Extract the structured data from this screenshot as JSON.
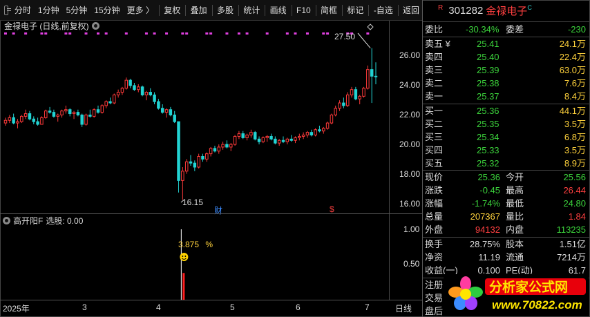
{
  "toolbar": {
    "items": [
      "分时",
      "1分钟",
      "5分钟",
      "15分钟",
      "更多 〉",
      "复权",
      "叠加",
      "多股",
      "统计",
      "画线",
      "F10",
      "简框",
      "标记",
      "-自选",
      "返回"
    ]
  },
  "chart": {
    "title": "金禄电子 (日线,前复权)",
    "high_label": "27.50",
    "low_label": "16.15",
    "marker_cai": "财",
    "marker_s": "$",
    "price_ticks": [
      "26.00",
      "24.00",
      "22.00",
      "20.00",
      "18.00",
      "16.00"
    ],
    "indicator_name": "高开阳F",
    "indicator_value": "选股: 0.00",
    "indicator_ticks": [
      "1.00",
      "0.50"
    ],
    "pct_label": "3.875",
    "pct_unit": "%",
    "x_ticks": [
      "2025年",
      "3",
      "4",
      "5",
      "6",
      "7"
    ],
    "period_label": "日线"
  },
  "chart_data": {
    "type": "candlestick",
    "ylim": [
      15.5,
      28.0
    ],
    "candles": [
      [
        21.9,
        22.3,
        21.7,
        22.1
      ],
      [
        22.1,
        22.5,
        21.9,
        22.3
      ],
      [
        22.3,
        22.6,
        21.8,
        21.9
      ],
      [
        21.9,
        22.2,
        21.5,
        22.0
      ],
      [
        22.0,
        22.5,
        21.9,
        22.4
      ],
      [
        22.4,
        22.9,
        22.2,
        22.6
      ],
      [
        22.6,
        22.8,
        22.1,
        22.2
      ],
      [
        22.2,
        22.4,
        21.8,
        22.0
      ],
      [
        22.0,
        22.3,
        21.7,
        21.8
      ],
      [
        21.8,
        22.4,
        21.8,
        22.3
      ],
      [
        22.3,
        22.9,
        22.2,
        22.8
      ],
      [
        22.8,
        23.1,
        22.6,
        22.7
      ],
      [
        22.7,
        22.9,
        22.3,
        22.4
      ],
      [
        22.4,
        22.6,
        22.0,
        22.5
      ],
      [
        22.5,
        22.9,
        22.3,
        22.8
      ],
      [
        22.8,
        23.2,
        22.6,
        22.9
      ],
      [
        22.9,
        23.0,
        22.4,
        22.6
      ],
      [
        22.6,
        22.8,
        22.2,
        22.7
      ],
      [
        22.7,
        22.9,
        22.4,
        22.5
      ],
      [
        22.5,
        22.6,
        21.6,
        21.8
      ],
      [
        21.8,
        22.6,
        21.7,
        22.5
      ],
      [
        22.5,
        22.9,
        22.3,
        22.4
      ],
      [
        22.4,
        23.0,
        22.3,
        22.9
      ],
      [
        22.9,
        23.2,
        22.6,
        22.7
      ],
      [
        22.7,
        23.3,
        22.6,
        23.2
      ],
      [
        23.2,
        23.6,
        23.0,
        23.5
      ],
      [
        23.5,
        23.8,
        23.3,
        23.4
      ],
      [
        23.4,
        24.1,
        23.3,
        24.0
      ],
      [
        24.0,
        24.4,
        23.8,
        24.2
      ],
      [
        24.2,
        24.6,
        24.0,
        24.5
      ],
      [
        24.5,
        25.3,
        24.4,
        25.1
      ],
      [
        25.1,
        25.2,
        24.5,
        24.7
      ],
      [
        24.7,
        24.9,
        24.3,
        24.4
      ],
      [
        24.4,
        24.8,
        24.2,
        24.6
      ],
      [
        24.6,
        24.7,
        23.9,
        24.0
      ],
      [
        24.0,
        24.3,
        23.6,
        24.2
      ],
      [
        24.2,
        24.5,
        23.9,
        24.0
      ],
      [
        24.0,
        24.2,
        23.3,
        23.5
      ],
      [
        23.5,
        23.7,
        22.9,
        23.0
      ],
      [
        23.0,
        23.3,
        22.6,
        22.7
      ],
      [
        22.7,
        23.0,
        22.3,
        22.9
      ],
      [
        22.9,
        23.1,
        22.4,
        22.5
      ],
      [
        22.5,
        22.8,
        21.9,
        22.0
      ],
      [
        22.0,
        20.4,
        16.7,
        17.6
      ],
      [
        17.6,
        18.6,
        16.15,
        18.3
      ],
      [
        18.3,
        19.2,
        18.1,
        19.0
      ],
      [
        19.0,
        19.5,
        18.7,
        18.9
      ],
      [
        18.9,
        19.1,
        18.3,
        18.6
      ],
      [
        18.6,
        19.6,
        18.5,
        19.4
      ],
      [
        19.4,
        19.6,
        19.0,
        19.2
      ],
      [
        19.2,
        19.7,
        19.0,
        19.6
      ],
      [
        19.6,
        20.1,
        19.4,
        20.0
      ],
      [
        20.0,
        20.2,
        19.7,
        19.8
      ],
      [
        19.8,
        20.3,
        19.6,
        20.1
      ],
      [
        20.1,
        20.5,
        19.9,
        20.3
      ],
      [
        20.3,
        20.6,
        20.0,
        20.1
      ],
      [
        20.1,
        20.4,
        19.8,
        20.3
      ],
      [
        20.3,
        21.0,
        20.2,
        20.9
      ],
      [
        20.9,
        21.3,
        20.7,
        21.1
      ],
      [
        21.1,
        21.3,
        20.7,
        20.8
      ],
      [
        20.8,
        21.1,
        20.6,
        21.0
      ],
      [
        21.0,
        21.4,
        20.8,
        21.2
      ],
      [
        21.2,
        21.3,
        20.6,
        20.7
      ],
      [
        20.7,
        20.9,
        20.3,
        20.5
      ],
      [
        20.5,
        20.9,
        20.4,
        20.8
      ],
      [
        20.8,
        21.0,
        20.5,
        20.9
      ],
      [
        20.9,
        21.1,
        20.6,
        20.7
      ],
      [
        20.7,
        20.9,
        20.3,
        20.4
      ],
      [
        20.4,
        20.7,
        20.2,
        20.6
      ],
      [
        20.6,
        20.9,
        20.4,
        20.5
      ],
      [
        20.5,
        20.8,
        20.3,
        20.7
      ],
      [
        20.7,
        21.0,
        20.5,
        20.6
      ],
      [
        20.6,
        20.9,
        20.4,
        20.8
      ],
      [
        20.8,
        21.1,
        20.6,
        20.9
      ],
      [
        20.9,
        21.2,
        20.7,
        21.0
      ],
      [
        21.0,
        21.3,
        20.8,
        21.2
      ],
      [
        21.2,
        21.4,
        20.9,
        21.0
      ],
      [
        21.0,
        21.5,
        20.9,
        21.4
      ],
      [
        21.4,
        21.7,
        21.2,
        21.3
      ],
      [
        21.3,
        21.6,
        21.1,
        21.5
      ],
      [
        21.5,
        22.0,
        21.4,
        21.9
      ],
      [
        21.9,
        22.6,
        21.8,
        22.5
      ],
      [
        22.5,
        23.2,
        22.4,
        23.0
      ],
      [
        23.0,
        23.6,
        22.8,
        23.4
      ],
      [
        23.4,
        23.8,
        23.0,
        23.2
      ],
      [
        23.2,
        24.2,
        23.1,
        24.0
      ],
      [
        24.0,
        24.6,
        23.8,
        24.4
      ],
      [
        24.4,
        24.6,
        23.6,
        23.7
      ],
      [
        23.7,
        24.0,
        23.3,
        23.9
      ],
      [
        23.9,
        24.6,
        23.8,
        24.5
      ],
      [
        24.5,
        26.2,
        24.4,
        25.9
      ],
      [
        25.9,
        27.5,
        23.4,
        25.4
      ],
      [
        25.4,
        26.44,
        24.8,
        25.36
      ]
    ],
    "indicator": {
      "spike_index": 44,
      "value": 1.0
    }
  },
  "quote": {
    "badge": "R",
    "code": "301282",
    "name": "金禄电子",
    "badge_c": "C",
    "weibi_label": "委比",
    "weibi_value": "-30.34%",
    "weicha_label": "委差",
    "weicha_value": "-230",
    "asks": [
      {
        "label": "卖五 ¥",
        "price": "25.41",
        "vol": "24.1万"
      },
      {
        "label": "卖四",
        "price": "25.40",
        "vol": "22.4万"
      },
      {
        "label": "卖三",
        "price": "25.39",
        "vol": "63.0万"
      },
      {
        "label": "卖二",
        "price": "25.38",
        "vol": "7.6万"
      },
      {
        "label": "卖一",
        "price": "25.37",
        "vol": "8.4万"
      }
    ],
    "bids": [
      {
        "label": "买一",
        "price": "25.36",
        "vol": "44.1万"
      },
      {
        "label": "买二",
        "price": "25.35",
        "vol": "3.5万"
      },
      {
        "label": "买三",
        "price": "25.34",
        "vol": "6.8万"
      },
      {
        "label": "买四",
        "price": "25.33",
        "vol": "3.5万"
      },
      {
        "label": "买五",
        "price": "25.32",
        "vol": "8.9万"
      }
    ],
    "stats": [
      {
        "l1": "现价",
        "v1": "25.36",
        "l2": "今开",
        "v2": "25.56"
      },
      {
        "l1": "涨跌",
        "v1": "-0.45",
        "l2": "最高",
        "v2": "26.44"
      },
      {
        "l1": "涨幅",
        "v1": "-1.74%",
        "l2": "最低",
        "v2": "24.80"
      },
      {
        "l1": "总量",
        "v1": "207367",
        "l2": "量比",
        "v2": "1.84"
      },
      {
        "l1": "外盘",
        "v1": "94132",
        "l2": "内盘",
        "v2": "113235"
      }
    ],
    "info": [
      {
        "l1": "换手",
        "v1": "28.75%",
        "l2": "股本",
        "v2": "1.51亿"
      },
      {
        "l1": "净资",
        "v1": "11.19",
        "l2": "流通",
        "v2": "7214万"
      },
      {
        "l1": "收益(一)",
        "v1": "0.100",
        "l2": "PE(动)",
        "v2": "61.7"
      }
    ],
    "extra": [
      "注册",
      "交易",
      "盘后"
    ]
  },
  "watermark": {
    "text": "分析家公式网",
    "url": "www.70822.com"
  },
  "colors": {
    "up": "#ff3a3a",
    "down": "#22d3d3",
    "accent_magenta": "#e040e0"
  }
}
